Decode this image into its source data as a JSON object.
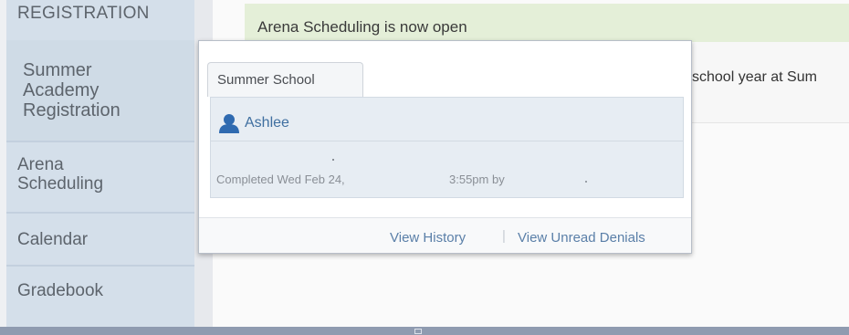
{
  "sidebar": {
    "items": [
      {
        "label": "REGISTRATION"
      },
      {
        "lines": [
          "Summer",
          "Academy",
          "Registration"
        ]
      },
      {
        "lines": [
          "Arena",
          "Scheduling"
        ]
      },
      {
        "label": "Calendar"
      },
      {
        "label": "Gradebook"
      }
    ]
  },
  "banner": {
    "text": "Arena Scheduling is now open"
  },
  "message": {
    "text": "school year at Sum"
  },
  "popover": {
    "tab_label": "Summer School",
    "user_name": "Ashlee",
    "status": {
      "completed": "Completed Wed Feb 24,",
      "time": "3:55pm by"
    },
    "footer": {
      "history": "View History",
      "separator": "|",
      "denials": "View Unread Denials"
    }
  },
  "colors": {
    "sidebar_bg": "#d4dfea",
    "banner_bg": "#e4efd8",
    "link": "#5a7fa8",
    "user_icon": "#2f6ab0"
  }
}
